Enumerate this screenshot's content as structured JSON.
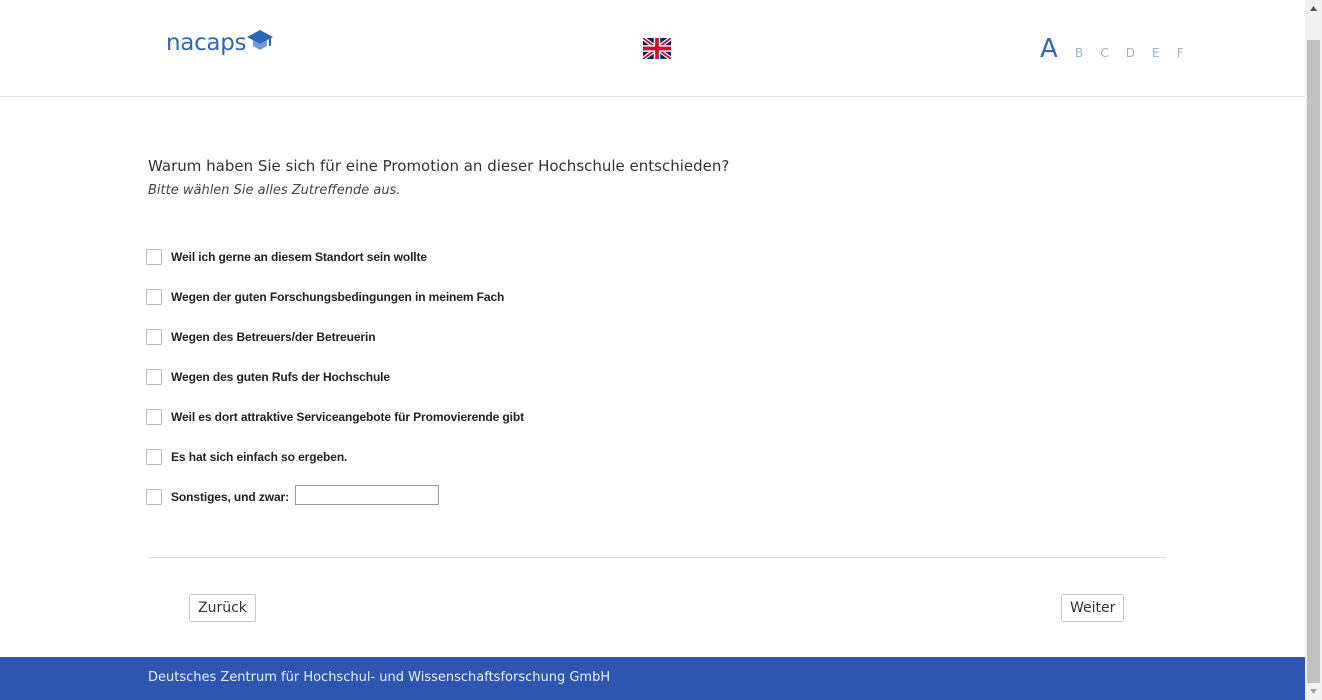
{
  "header": {
    "logo_text": "nacaps",
    "language_icon": "uk-flag-icon",
    "progress": {
      "current": "A",
      "steps": [
        "B",
        "C",
        "D",
        "E",
        "F"
      ]
    }
  },
  "question": {
    "text": "Warum haben Sie sich für eine Promotion an dieser Hochschule entschieden?",
    "instruction": "Bitte wählen Sie alles Zutreffende aus."
  },
  "options": [
    {
      "label": "Weil ich gerne an diesem Standort sein wollte",
      "checked": false
    },
    {
      "label": "Wegen der guten Forschungsbedingungen in meinem Fach",
      "checked": false
    },
    {
      "label": "Wegen des Betreuers/der Betreuerin",
      "checked": false
    },
    {
      "label": "Wegen des guten Rufs der Hochschule",
      "checked": false
    },
    {
      "label": "Weil es dort attraktive Serviceangebote für Promovierende gibt",
      "checked": false
    },
    {
      "label": "Es hat sich einfach so ergeben.",
      "checked": false
    },
    {
      "label": "Sonstiges, und zwar:",
      "checked": false,
      "input_value": ""
    }
  ],
  "nav": {
    "back_label": "Zurück",
    "next_label": "Weiter"
  },
  "footer": {
    "text": "Deutsches Zentrum für Hochschul- und Wissenschaftsforschung GmbH"
  },
  "colors": {
    "brand": "#2e67b8",
    "footer_bg": "#2e56b1"
  }
}
